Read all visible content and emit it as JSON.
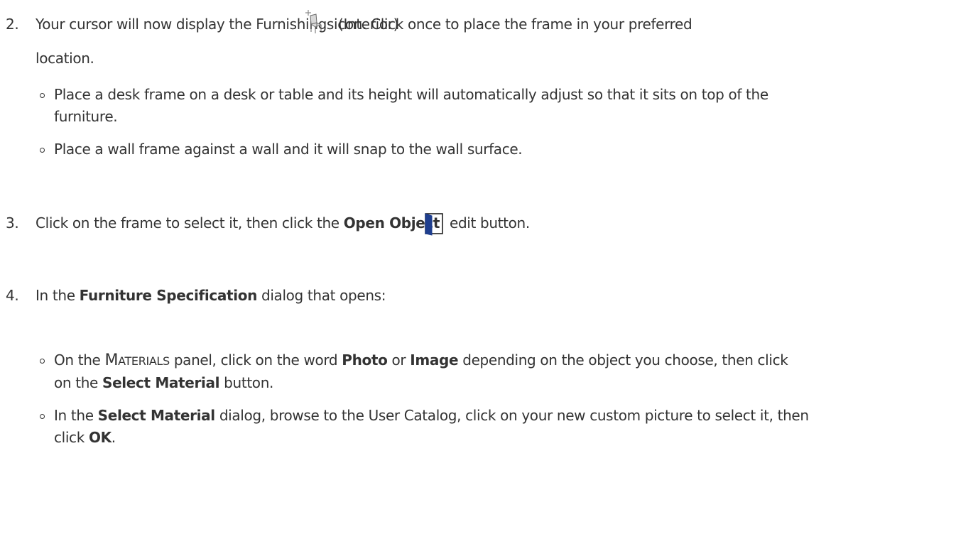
{
  "step2": {
    "number": "2.",
    "text_a": "Your cursor will now display the Furnishings (Interior)",
    "text_b": "icon. Click once to place the frame in your preferred",
    "text_c": "location.",
    "bullets": [
      {
        "line1": "Place a desk frame on a desk or table and its height will automatically adjust so that it sits on top of the",
        "line2": "furniture."
      },
      {
        "line1": "Place a wall frame against a wall and it will snap to the wall surface."
      }
    ],
    "icon": "furnishings-interior-chair-icon"
  },
  "step3": {
    "number": "3.",
    "text_a": "Click on the frame to select it, then click the",
    "bold": "Open Object",
    "text_b": "edit button.",
    "icon": "open-object-door-icon"
  },
  "step4": {
    "number": "4.",
    "text_a": "In the",
    "bold": "Furniture Specification",
    "text_b": "dialog that opens:",
    "bullet1": {
      "a": "On the",
      "materials_first": "M",
      "materials_rest": "ATERIALS",
      "b": "panel, click on the word",
      "photo": "Photo",
      "or": "or",
      "image": "Image",
      "c": "depending on the object you choose, then click",
      "d": "on the",
      "select_material": "Select Material",
      "e": "button."
    },
    "bullet2": {
      "a": "In the",
      "select_material": "Select Material",
      "b": "dialog, browse to the User Catalog, click on your new custom picture to select it, then",
      "c": "click",
      "ok": "OK",
      "d": "."
    }
  },
  "colors": {
    "text": "#333333",
    "door_icon": "#1f3f8f"
  }
}
